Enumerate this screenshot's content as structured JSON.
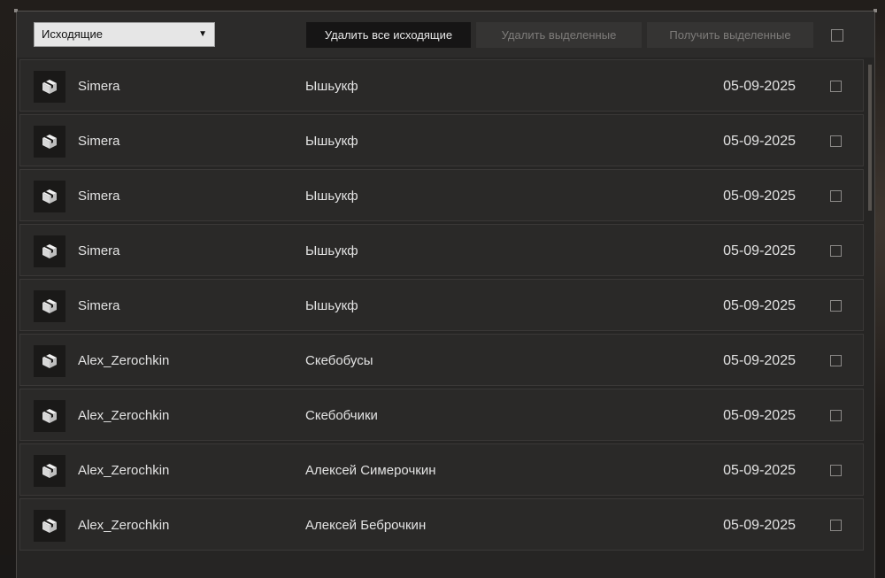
{
  "toolbar": {
    "folder_select": {
      "value": "Исходящие"
    },
    "delete_all_label": "Удалить все исходящие",
    "delete_selected_label": "Удалить выделенные",
    "receive_selected_label": "Получить выделенные"
  },
  "messages": [
    {
      "sender": "Simera",
      "subject": "Ышьукф",
      "date": "05-09-2025"
    },
    {
      "sender": "Simera",
      "subject": "Ышьукф",
      "date": "05-09-2025"
    },
    {
      "sender": "Simera",
      "subject": "Ышьукф",
      "date": "05-09-2025"
    },
    {
      "sender": "Simera",
      "subject": "Ышьукф",
      "date": "05-09-2025"
    },
    {
      "sender": "Simera",
      "subject": "Ышьукф",
      "date": "05-09-2025"
    },
    {
      "sender": "Alex_Zerochkin",
      "subject": "Скебобусы",
      "date": "05-09-2025"
    },
    {
      "sender": "Alex_Zerochkin",
      "subject": "Скебобчики",
      "date": "05-09-2025"
    },
    {
      "sender": "Alex_Zerochkin",
      "subject": "Алексей Симерочкин",
      "date": "05-09-2025"
    },
    {
      "sender": "Alex_Zerochkin",
      "subject": "Алексей Беброчкин",
      "date": "05-09-2025"
    }
  ],
  "icons": {
    "message_icon": "package-box-icon"
  },
  "colors": {
    "primary_button": "#161515",
    "disabled_button": "#353433",
    "text": "#e3e3e3"
  }
}
